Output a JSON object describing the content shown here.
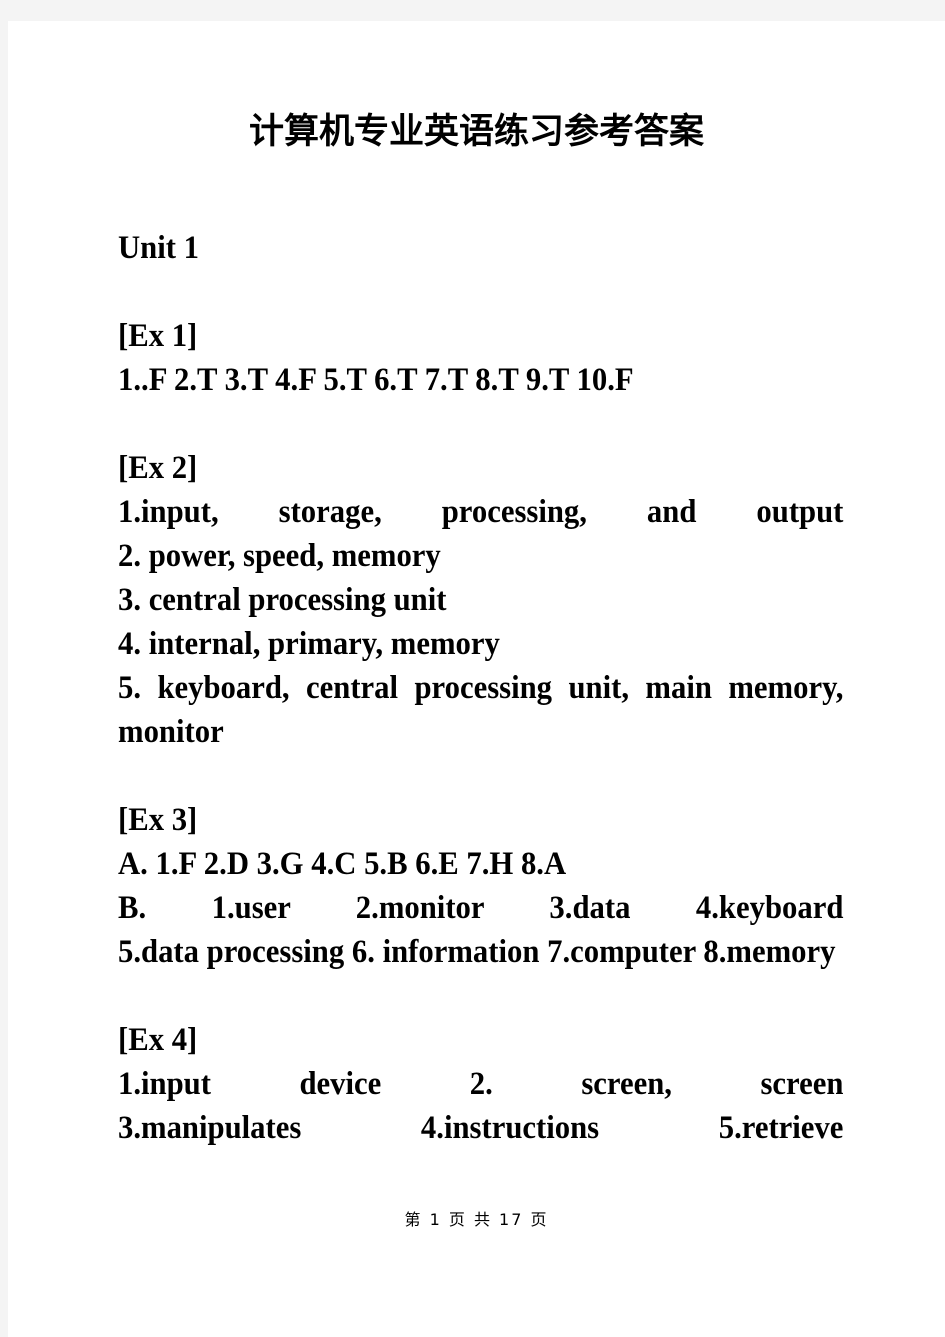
{
  "document": {
    "title": "计算机专业英语练习参考答案",
    "unit_heading": "Unit 1",
    "sections": [
      {
        "heading": "[Ex 1]",
        "lines": [
          "1..F  2.T  3.T  4.F  5.T  6.T  7.T  8.T  9.T  10.F"
        ]
      },
      {
        "heading": "[Ex 2]",
        "lines": [
          "1.input,  storage,  processing,  and  output",
          "2.  power,  speed,  memory",
          "3.  central  processing  unit",
          "4.  internal,  primary,  memory",
          "5.  keyboard,  central  processing  unit,  main  memory,  monitor"
        ]
      },
      {
        "heading": "[Ex 3]",
        "lines": [
          "A.  1.F  2.D  3.G  4.C  5.B  6.E  7.H  8.A",
          "B.  1.user   2.monitor   3.data   4.keyboard",
          "5.data  processing  6.  information  7.computer  8.memory"
        ]
      },
      {
        "heading": "[Ex 4]",
        "lines": [
          "1.input  device  2.  screen,  screen",
          "3.manipulates   4.instructions   5.retrieve"
        ]
      }
    ],
    "footer": "第 1 页 共 17 页"
  },
  "colors": {
    "page_background": "#ffffff",
    "gutter": "#f4f4f4",
    "text": "#000000"
  }
}
